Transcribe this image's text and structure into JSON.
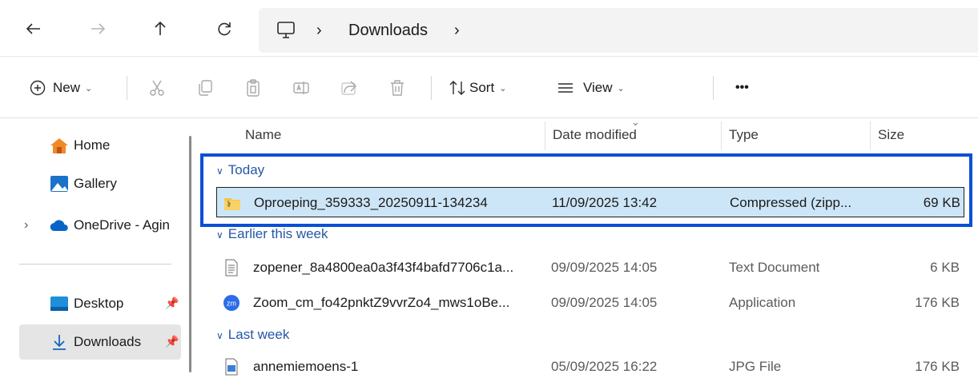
{
  "address": {
    "crumbs": [
      "Downloads"
    ],
    "separator": "›"
  },
  "toolbar": {
    "new_label": "New",
    "sort_label": "Sort",
    "view_label": "View",
    "more_label": "•••",
    "chevron": "⌄"
  },
  "nav": {
    "items": [
      {
        "label": "Home",
        "icon": "home-icon"
      },
      {
        "label": "Gallery",
        "icon": "gallery-icon"
      },
      {
        "label": "OneDrive - Agin",
        "icon": "onedrive-icon"
      },
      {
        "label": "Desktop",
        "icon": "desktop-icon"
      },
      {
        "label": "Downloads",
        "icon": "downloads-icon"
      }
    ],
    "expand_glyph": "›"
  },
  "columns": {
    "name": "Name",
    "date": "Date modified",
    "type": "Type",
    "size": "Size",
    "sort_glyph": "⌄"
  },
  "groups": [
    {
      "label": "Today",
      "files": [
        {
          "name": "Oproeping_359333_20250911-134234",
          "date": "11/09/2025 13:42",
          "type": "Compressed (zipp...",
          "size": "69 KB",
          "icon": "zip-folder-icon",
          "selected": true
        }
      ]
    },
    {
      "label": "Earlier this week",
      "files": [
        {
          "name": "zopener_8a4800ea0a3f43f4bafd7706c1a...",
          "date": "09/09/2025 14:05",
          "type": "Text Document",
          "size": "6 KB",
          "icon": "text-file-icon"
        },
        {
          "name": "Zoom_cm_fo42pnktZ9vvrZo4_mws1oBe...",
          "date": "09/09/2025 14:05",
          "type": "Application",
          "size": "176 KB",
          "icon": "zoom-app-icon"
        }
      ]
    },
    {
      "label": "Last week",
      "files": [
        {
          "name": "annemiemoens-1",
          "date": "05/09/2025 16:22",
          "type": "JPG File",
          "size": "176 KB",
          "icon": "image-file-icon"
        }
      ]
    }
  ],
  "colors": {
    "accent": "#0a4fd6",
    "selection": "#cde6f7",
    "group_text": "#2458a6"
  }
}
